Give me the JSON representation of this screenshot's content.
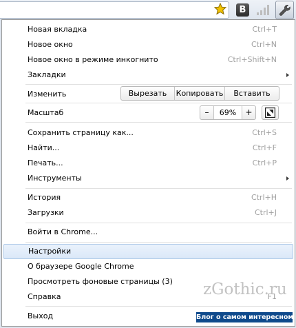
{
  "toolbar": {
    "extension_label": "B",
    "icons": [
      "star-icon",
      "extension-b-icon",
      "signal-bars-icon",
      "wrench-icon"
    ],
    "star_color": "#f2c200"
  },
  "menu": {
    "new_tab": {
      "label": "Новая вкладка",
      "shortcut": "Ctrl+T"
    },
    "new_window": {
      "label": "Новое окно",
      "shortcut": "Ctrl+N"
    },
    "new_incognito": {
      "label": "Новое окно в режиме инкогнито",
      "shortcut": "Ctrl+Shift+N"
    },
    "bookmarks": {
      "label": "Закладки"
    },
    "edit": {
      "label": "Изменить",
      "cut": "Вырезать",
      "copy": "Копировать",
      "paste": "Вставить"
    },
    "zoom": {
      "label": "Масштаб",
      "minus": "–",
      "value": "69%",
      "plus": "+"
    },
    "save_page": {
      "label": "Сохранить страницу как...",
      "shortcut": "Ctrl+S"
    },
    "find": {
      "label": "Найти...",
      "shortcut": "Ctrl+F"
    },
    "print": {
      "label": "Печать...",
      "shortcut": "Ctrl+P"
    },
    "tools": {
      "label": "Инструменты"
    },
    "history": {
      "label": "История",
      "shortcut": "Ctrl+H"
    },
    "downloads": {
      "label": "Загрузки",
      "shortcut": "Ctrl+J"
    },
    "sign_in": {
      "label": "Войти в Chrome..."
    },
    "settings": {
      "label": "Настройки"
    },
    "about": {
      "label": "О браузере Google Chrome"
    },
    "background_pages": {
      "label": "Просмотреть фоновые страницы (3)"
    },
    "help": {
      "label": "Справка",
      "shortcut": "F1"
    },
    "exit": {
      "label": "Выход"
    }
  },
  "watermark": {
    "site": "zGothic.ru",
    "tagline": "Блог о самом интересном"
  }
}
